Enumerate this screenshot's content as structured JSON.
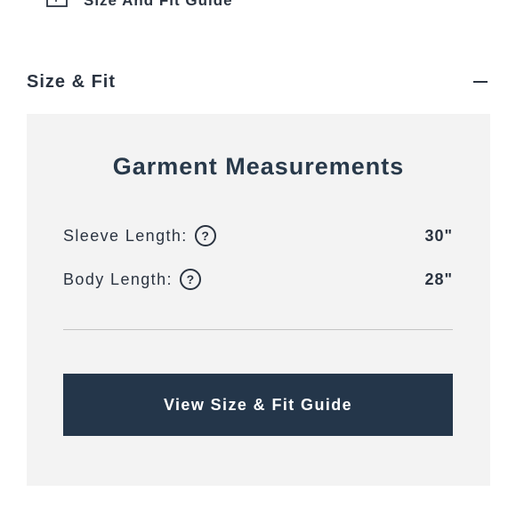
{
  "size_guide_link": {
    "label": "Size And Fit Guide",
    "icon": "ruler-icon"
  },
  "section": {
    "title": "Size & Fit",
    "toggle_icon": "minus-icon"
  },
  "measurements": {
    "title": "Garment Measurements",
    "rows": [
      {
        "label": "Sleeve Length:",
        "value": "30\"",
        "help_glyph": "?"
      },
      {
        "label": "Body Length:",
        "value": "28\"",
        "help_glyph": "?"
      }
    ],
    "button_label": "View Size & Fit Guide"
  },
  "colors": {
    "text": "#2b3441",
    "panel_bg": "#f3f3f3",
    "button_bg": "#24364a",
    "button_text": "#ffffff"
  }
}
